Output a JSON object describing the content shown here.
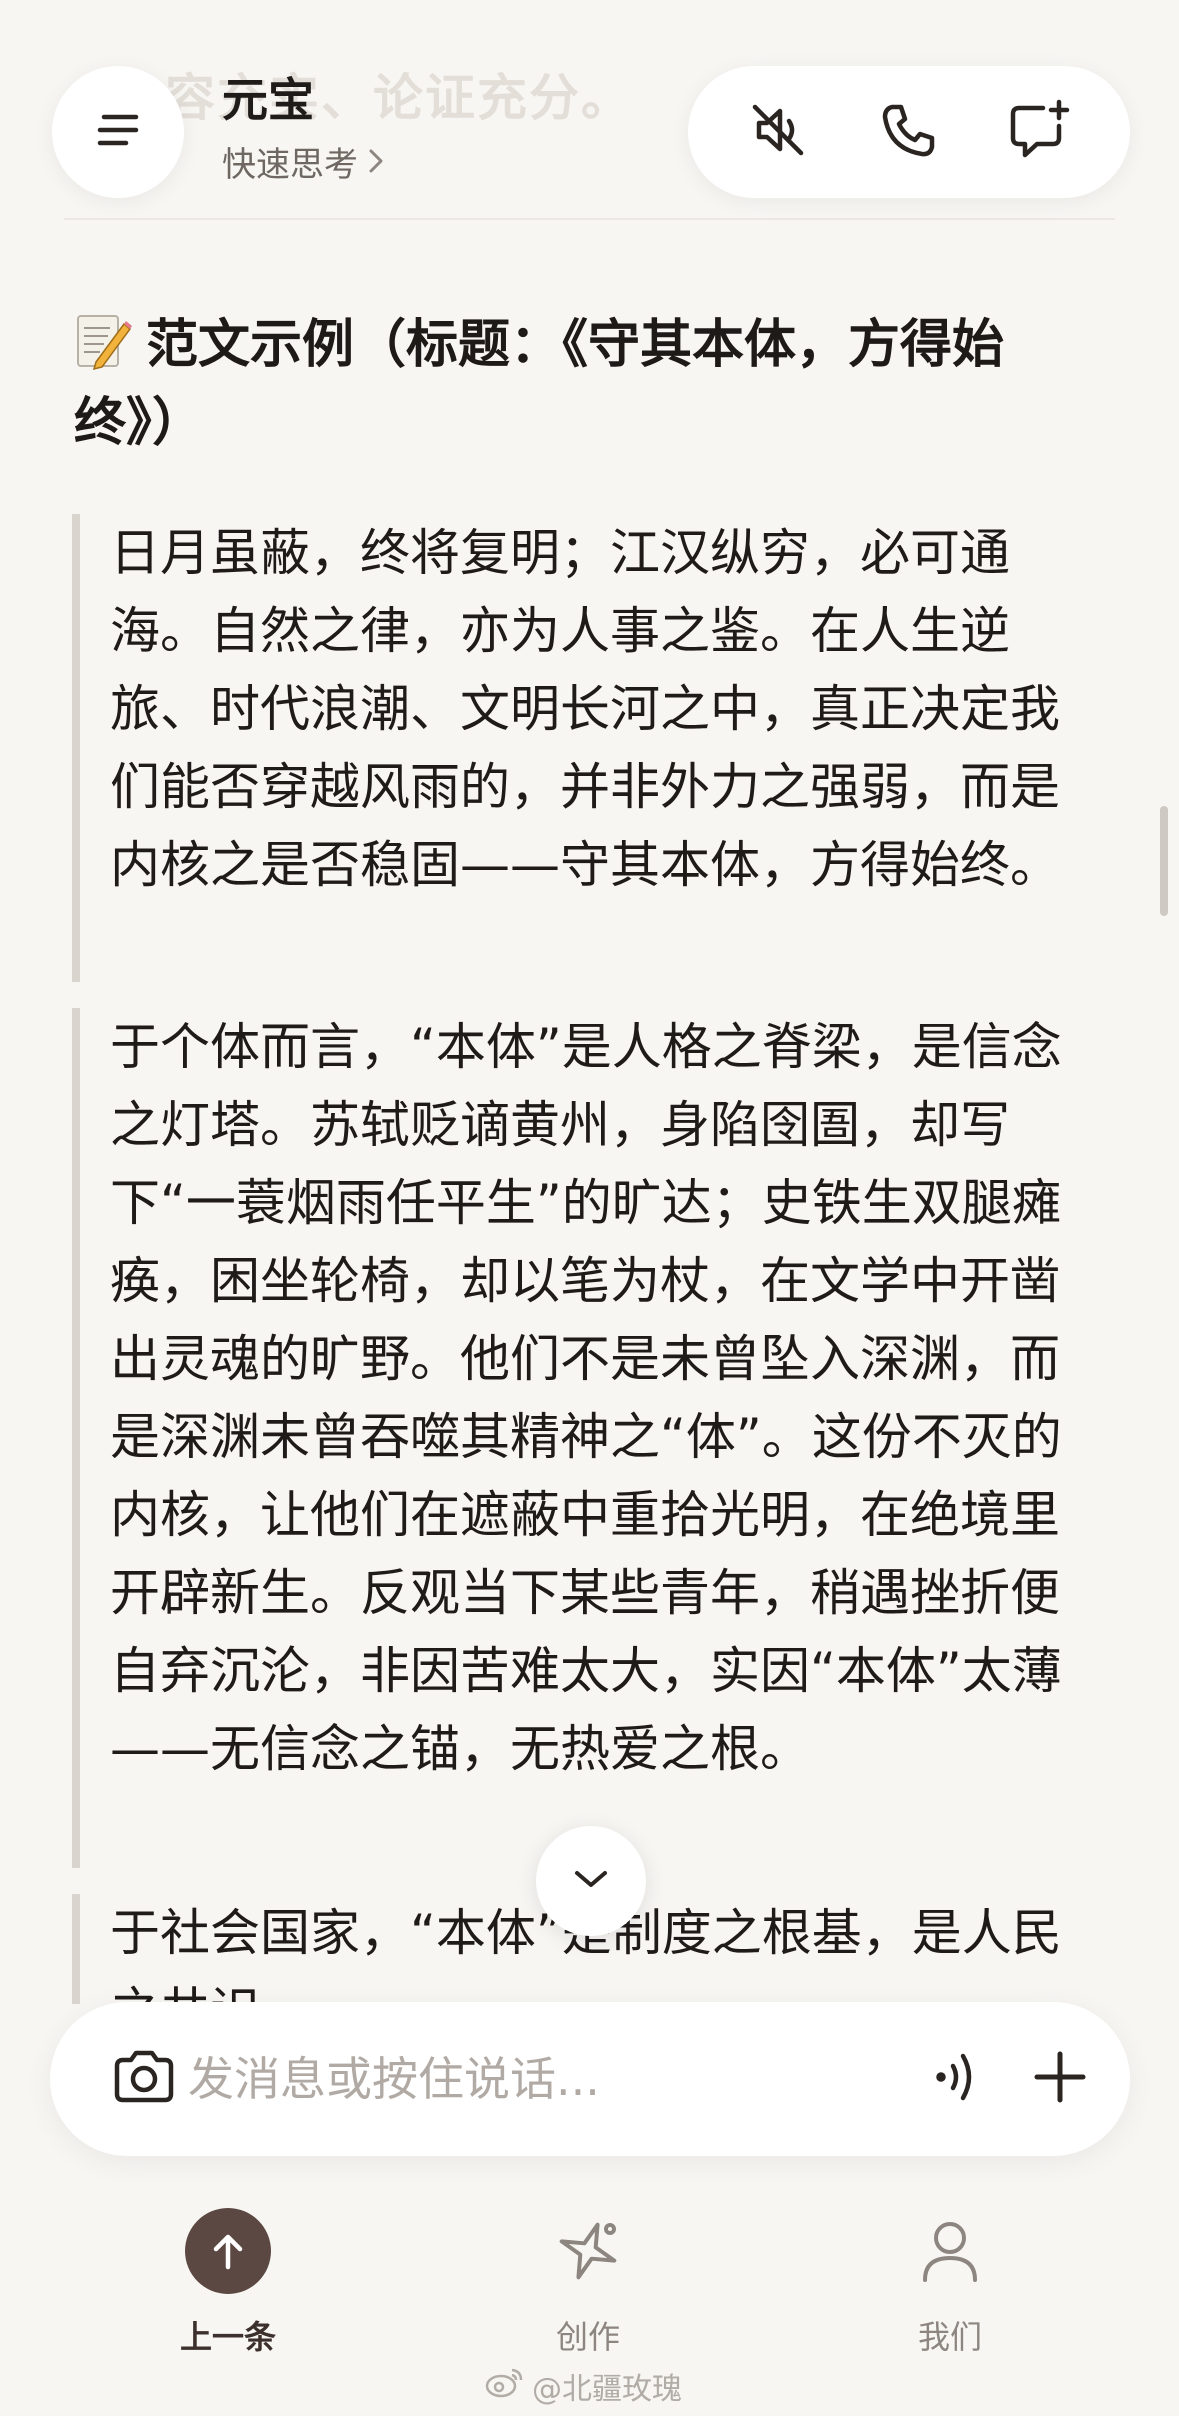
{
  "header": {
    "scrolled_text": "容充实、论证充分。",
    "app_title": "元宝",
    "mode_label": "快速思考",
    "icons": {
      "menu": "menu-icon",
      "mute": "speaker-muted-icon",
      "call": "phone-icon",
      "new_chat": "new-chat-icon"
    }
  },
  "content": {
    "heading_icon": "memo-emoji-icon",
    "heading": "范文示例（标题：《守其本体，方得始终》）",
    "paragraphs": [
      "日月虽蔽，终将复明；江汉纵穷，必可通海。自然之律，亦为人事之鉴。在人生逆旅、时代浪潮、文明长河之中，真正决定我们能否穿越风雨的，并非外力之强弱，而是内核之是否稳固——守其本体，方得始终。",
      "于个体而言，“本体”是人格之脊梁，是信念之灯塔。苏轼贬谪黄州，身陷囹圄，却写下“一蓑烟雨任平生”的旷达；史铁生双腿瘫痪，困坐轮椅，却以笔为杖，在文学中开凿出灵魂的旷野。他们不是未曾坠入深渊，而是深渊未曾吞噬其精神之“体”。这份不灭的内核，让他们在遮蔽中重拾光明，在绝境里开辟新生。反观当下某些青年，稍遇挫折便自弃沉沦，非因苦难太大，实因“本体”太薄——无信念之锚，无热爱之根。",
      "于社会国家，“本体”是制度之根基，是人民之共识。"
    ]
  },
  "input": {
    "placeholder": "发消息或按住说话...",
    "icons": {
      "camera": "camera-icon",
      "voice": "voice-wave-icon",
      "plus": "plus-icon"
    }
  },
  "bottom_nav": {
    "items": [
      {
        "label": "上一条",
        "icon": "arrow-up-icon",
        "active": true
      },
      {
        "label": "创作",
        "icon": "create-sparkle-icon",
        "active": false
      },
      {
        "label": "我们",
        "icon": "person-icon",
        "active": false
      }
    ]
  },
  "watermark": "@北疆玫瑰",
  "colors": {
    "background": "#f8f6f3",
    "text": "#1d1a18",
    "muted": "#8d8680",
    "accent": "#5c4842",
    "quote_bar": "#d9d4ce"
  }
}
